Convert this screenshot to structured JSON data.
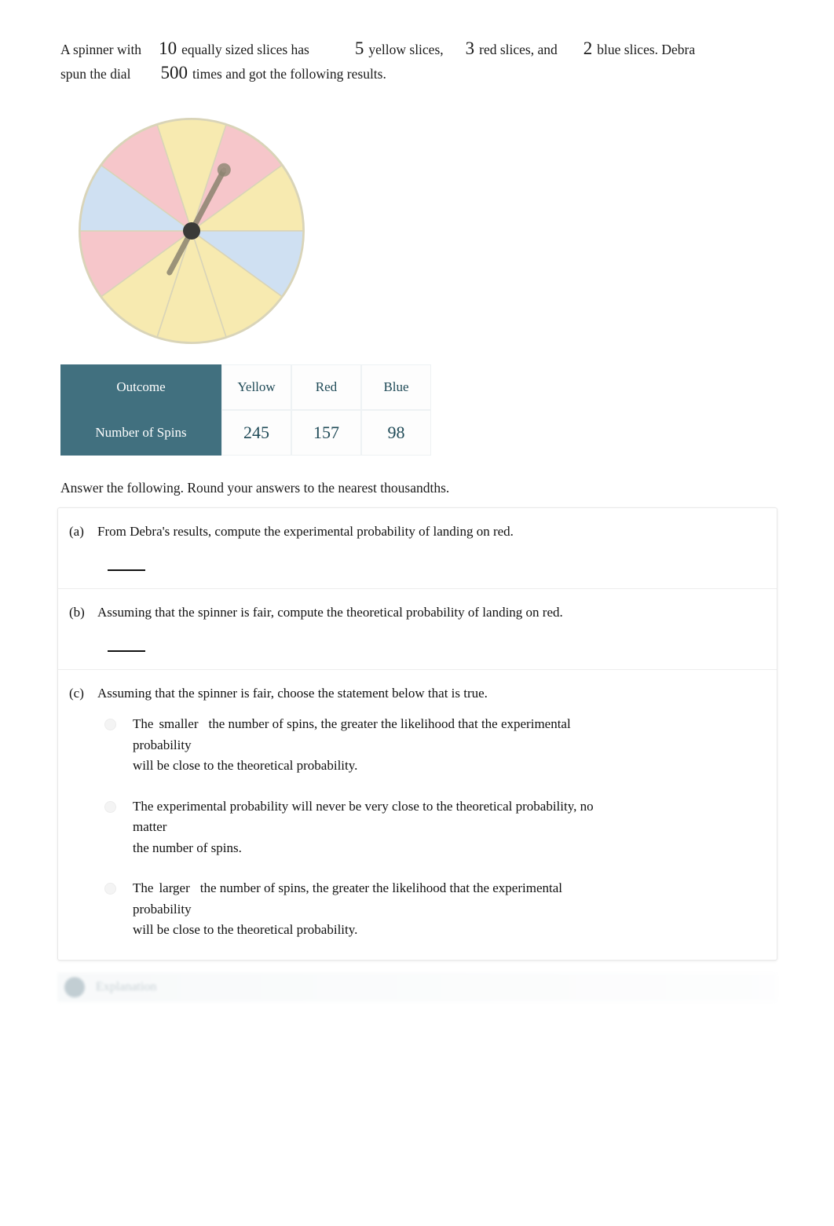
{
  "problem": {
    "line1_part1": "A spinner with",
    "total_slices": "10",
    "line1_part2": "equally sized slices has",
    "yellow_count": "5",
    "line1_part3": "yellow slices,",
    "red_count": "3",
    "line1_part4": "red slices, and",
    "blue_count": "2",
    "line1_part5": "blue slices. Debra",
    "line2_part1": "spun the dial",
    "spins": "500",
    "line2_part2": "times and got the following results."
  },
  "spinner": {
    "slice_count": 10,
    "colors": {
      "yellow": "#f7eab0",
      "red": "#f6c6ca",
      "blue": "#cfe0f2",
      "edge": "#d9d4b8",
      "hub": "#3a3a38",
      "needle": "#8c8470"
    },
    "slice_sequence": [
      "yellow",
      "red",
      "yellow",
      "blue",
      "yellow",
      "yellow",
      "yellow",
      "red",
      "blue",
      "red"
    ],
    "needle_angle_deg": 28
  },
  "table": {
    "row_labels": [
      "Outcome",
      "Number of Spins"
    ],
    "outcomes": [
      "Yellow",
      "Red",
      "Blue"
    ],
    "spins": [
      "245",
      "157",
      "98"
    ],
    "header_color": "#41707f",
    "text_color": "#1f4a57"
  },
  "instruction": "Answer the following. Round your answers to the nearest thousandths.",
  "questions": [
    {
      "letter": "(a)",
      "text": "From Debra's results, compute the experimental probability of landing on red.",
      "has_blank": true
    },
    {
      "letter": "(b)",
      "text": "Assuming that the spinner is fair, compute the theoretical probability of landing on red.",
      "has_blank": true
    },
    {
      "letter": "(c)",
      "text": "Assuming that the spinner is fair, choose the statement below that is true.",
      "has_blank": false
    }
  ],
  "choices": [
    {
      "lead": "The",
      "emph": "smaller",
      "rest_line1": "the number of spins, the greater the likelihood that the experimental",
      "line2": "probability",
      "line3": "will be close to the theoretical probability."
    },
    {
      "lead": "",
      "emph": "",
      "rest_line1": "The experimental probability will never be very close to the theoretical probability, no",
      "line2": "matter",
      "line3": "the number of spins."
    },
    {
      "lead": "The",
      "emph": "larger",
      "rest_line1": "the number of spins, the greater the likelihood that the experimental",
      "line2": "probability",
      "line3": "will be close to the theoretical probability."
    }
  ],
  "explanation_bar": {
    "label": "Explanation"
  }
}
